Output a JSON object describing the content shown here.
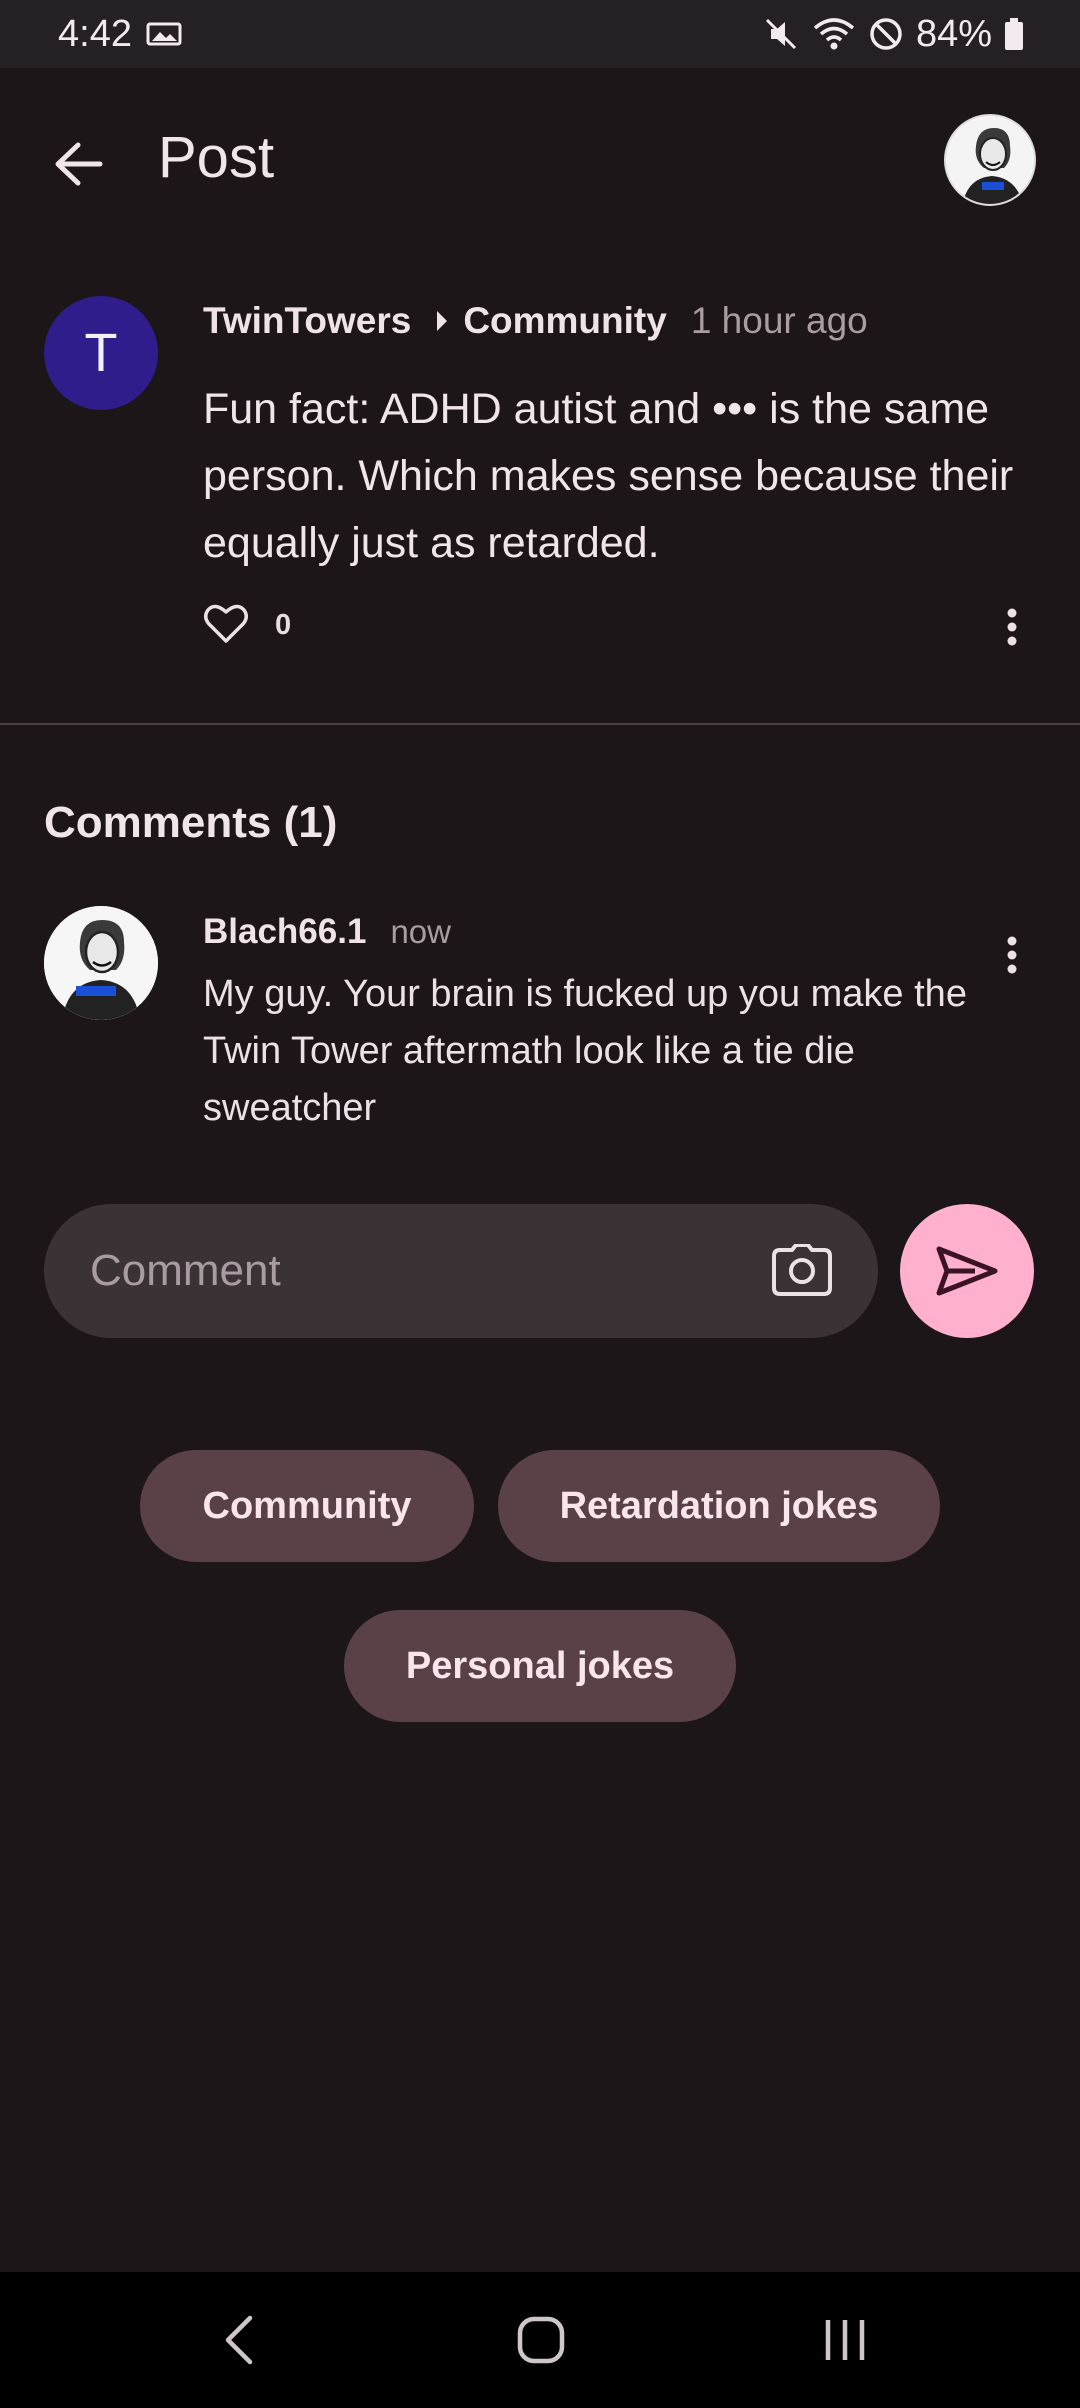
{
  "status_bar": {
    "time": "4:42",
    "battery": "84%",
    "icons": [
      "gallery-icon",
      "mute-icon",
      "wifi-icon",
      "do-not-disturb-icon",
      "battery-icon"
    ]
  },
  "header": {
    "title": "Post",
    "back_icon": "arrow-back-icon"
  },
  "post": {
    "avatar_letter": "T",
    "author": "TwinTowers",
    "community": "Community",
    "time": "1 hour ago",
    "body": "Fun fact: ADHD autist and ••• is the same person. Which makes sense because their equally just as retarded.",
    "likes": "0",
    "colors": {
      "avatar_bg": "#2e1d8a"
    }
  },
  "comments": {
    "heading": "Comments (1)",
    "items": [
      {
        "author": "Blach66.1",
        "time": "now",
        "body": "My guy. Your brain is fucked up you make the Twin Tower aftermath look like a tie die sweatcher"
      }
    ]
  },
  "composer": {
    "placeholder": "Comment",
    "value": ""
  },
  "tags": [
    "Community",
    "Retardation jokes",
    "Personal jokes"
  ],
  "colors": {
    "background": "#1c1618",
    "accent": "#ffb0cd",
    "chip_bg": "#5a4148",
    "input_bg": "#3b3236"
  }
}
